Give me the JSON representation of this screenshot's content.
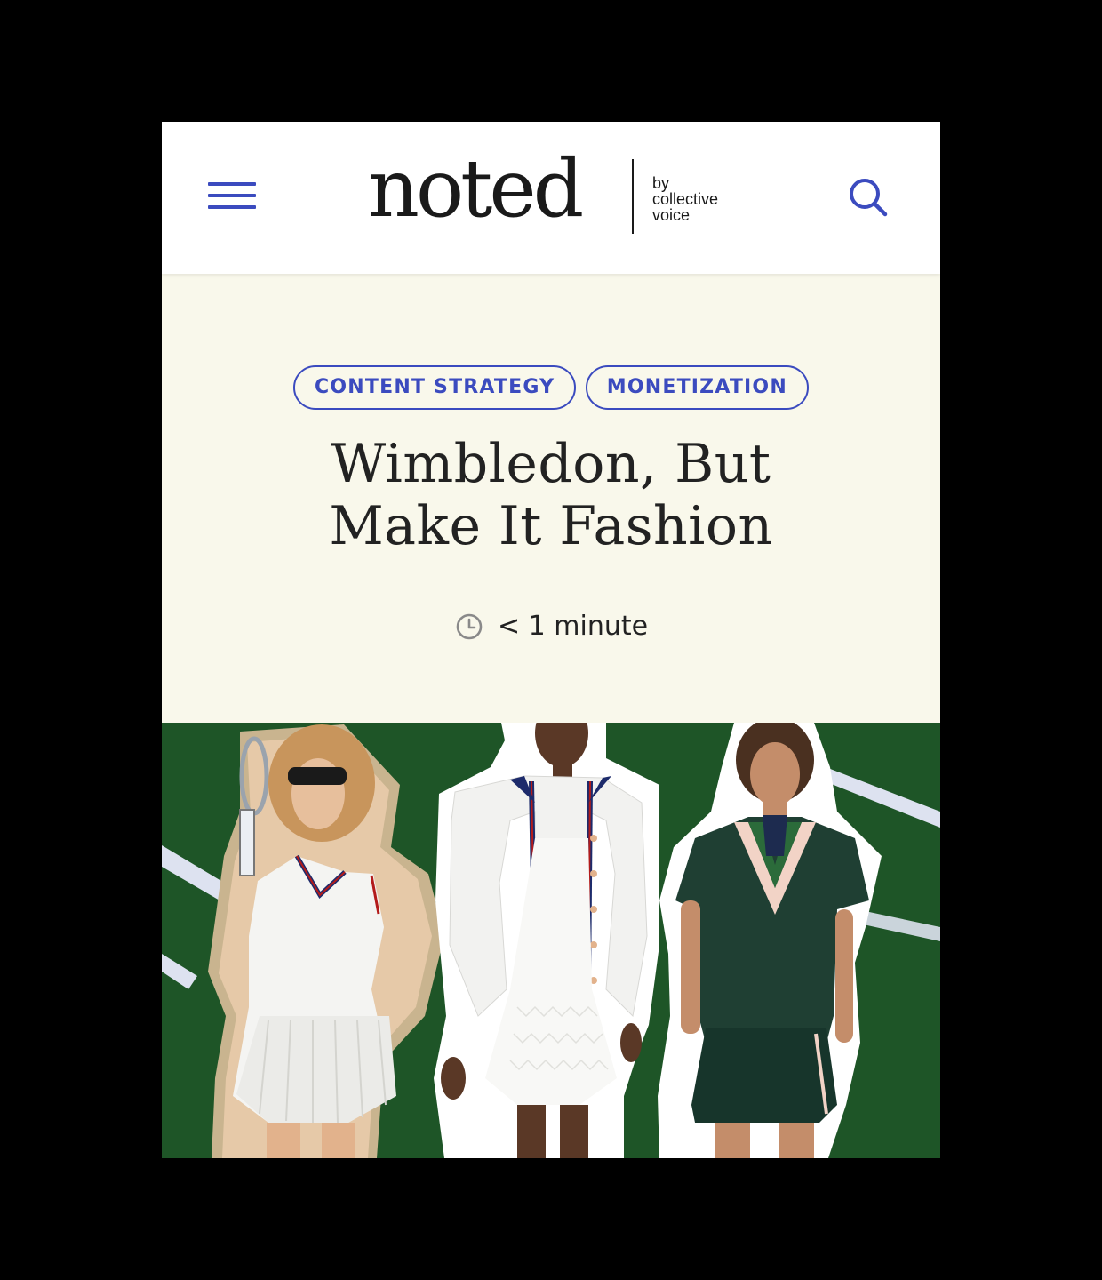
{
  "header": {
    "logo": {
      "word": "noted",
      "by_line_1": "by",
      "by_line_2": "collective",
      "by_line_3": "voice"
    }
  },
  "article": {
    "tags": [
      "CONTENT STRATEGY",
      "MONETIZATION"
    ],
    "title_line_1": "Wimbledon, But",
    "title_line_2": "Make It Fashion",
    "read_time": "< 1 minute"
  },
  "colors": {
    "accent": "#3b4bbf",
    "hero_background": "#f9f8eb",
    "header_background": "#ffffff",
    "court_green": "#215a2a"
  },
  "icons": {
    "menu": "hamburger-menu-icon",
    "search": "search-icon",
    "clock": "clock-icon"
  }
}
